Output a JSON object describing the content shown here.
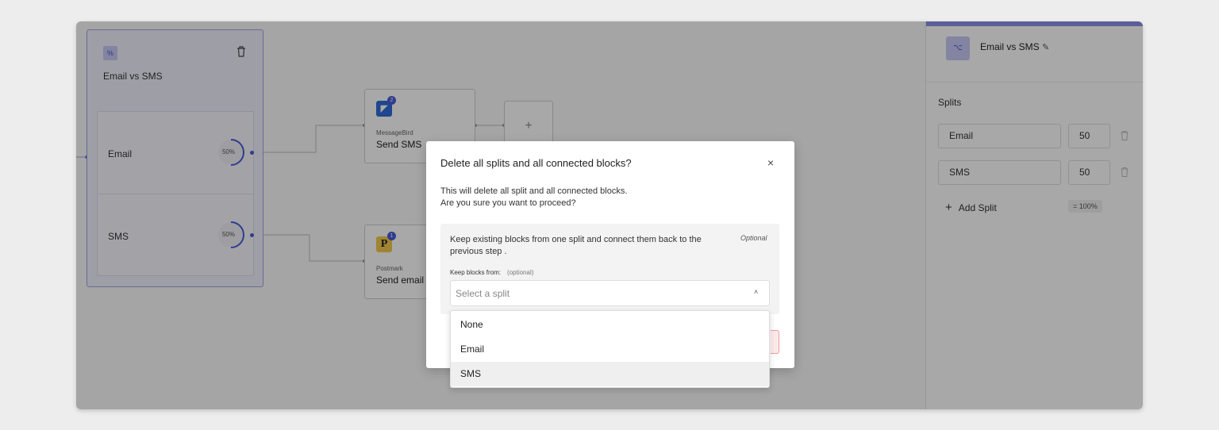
{
  "split_block": {
    "title": "Email vs SMS",
    "icon": "split-percent-icon",
    "rows": [
      {
        "label": "Email",
        "percent": "50%"
      },
      {
        "label": "SMS",
        "percent": "50%"
      }
    ]
  },
  "actions": [
    {
      "provider": "MessageBird",
      "name": "Send SMS",
      "badge": "2",
      "icon_glyph": "◤",
      "color": "#2f6bd8"
    },
    {
      "provider": "Postmark",
      "name": "Send email",
      "badge": "1",
      "icon_glyph": "P",
      "color": "#f2c94c"
    }
  ],
  "add_block_symbol": "+",
  "panel": {
    "title": "Email vs SMS",
    "icon_glyph": "⌥",
    "edit_icon_glyph": "✎",
    "splits_heading": "Splits",
    "splits": [
      {
        "name": "Email",
        "value": "50"
      },
      {
        "name": "SMS",
        "value": "50"
      }
    ],
    "add_split_label": "Add Split",
    "add_split_symbol": "+",
    "total": "= 100%"
  },
  "modal": {
    "title": "Delete all splits and all connected blocks?",
    "close_symbol": "×",
    "desc_line1": "This will delete all split and all connected blocks.",
    "desc_line2": "Are you sure you want to proceed?",
    "option_text": "Keep existing blocks from one split and connect them back to the previous step .",
    "option_tag": "Optional",
    "keep_label": "Keep blocks from:",
    "keep_hint": "(optional)",
    "select_placeholder": "Select a split",
    "chevron_symbol": "˄"
  },
  "dropdown": {
    "options": [
      "None",
      "Email",
      "SMS"
    ],
    "selected": "SMS"
  },
  "colors": {
    "accent": "#4a5bd6",
    "panel_top": "#8b8fe6"
  }
}
